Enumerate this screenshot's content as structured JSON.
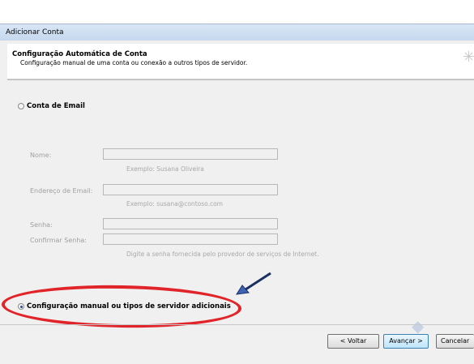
{
  "window": {
    "title": "Adicionar Conta"
  },
  "header": {
    "title": "Configuração Automática de Conta",
    "subtitle": "Configuração manual de uma conta ou conexão a outros tipos de servidor."
  },
  "email_account": {
    "radio_label": "Conta de Email",
    "fields": {
      "name": {
        "label": "Nome:",
        "value": "",
        "hint": "Exemplo: Susana Oliveira"
      },
      "email": {
        "label": "Endereço de Email:",
        "value": "",
        "hint": "Exemplo: susana@contoso.com"
      },
      "password": {
        "label": "Senha:",
        "value": ""
      },
      "confirm_password": {
        "label": "Confirmar Senha:",
        "value": "",
        "hint": "Digite a senha fornecida pelo provedor de serviços de Internet."
      }
    }
  },
  "manual_config": {
    "radio_label": "Configuração manual ou tipos de servidor adicionais",
    "selected": true
  },
  "buttons": {
    "back": "< Voltar",
    "next": "Avançar >",
    "cancel": "Cancelar"
  },
  "colors": {
    "annotation_ellipse": "#e0242a",
    "arrow": "#3e63b4"
  }
}
